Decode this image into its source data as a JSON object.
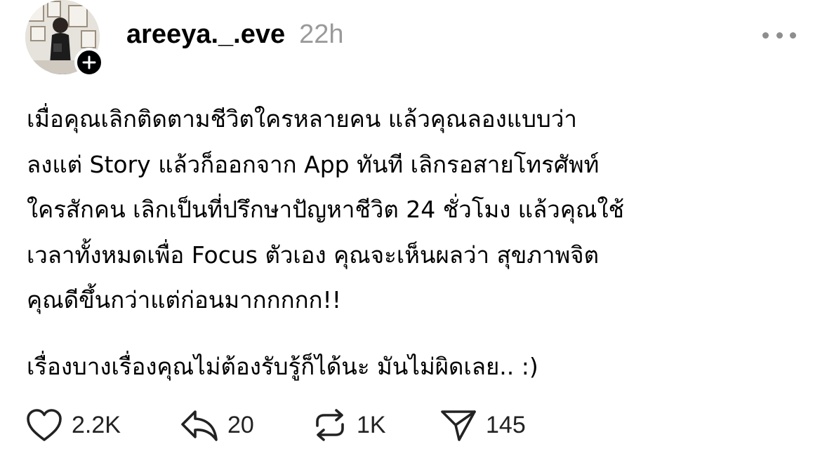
{
  "post": {
    "username": "areeya._.eve",
    "timestamp": "22h",
    "body_paragraphs": [
      "เมื่อคุณเลิกติดตามชีวิตใครหลายคน แล้วคุณลองแบบว่า\nลงแต่ Story แล้วก็ออกจาก App ทันที เลิกรอสายโทรศัพท์\nใครสักคน เลิกเป็นที่ปรึกษาปัญหาชีวิต 24 ชั่วโมง แล้วคุณใช้\nเวลาทั้งหมดเพื่อ Focus ตัวเอง คุณจะเห็นผลว่า สุขภาพจิต\nคุณดีขึ้นกว่าแต่ก่อนมากกกกก!!",
      "เรื่องบางเรื่องคุณไม่ต้องรับรู้ก็ได้นะ มันไม่ผิดเลย.. :)"
    ]
  },
  "actions": {
    "like_count": "2.2K",
    "reply_count": "20",
    "repost_count": "1K",
    "share_count": "145"
  },
  "icons": {
    "like": "heart-icon",
    "reply": "reply-arrow-icon",
    "repost": "repost-icon",
    "share": "send-icon",
    "more": "more-horizontal-icon",
    "follow": "plus-icon"
  },
  "colors": {
    "text": "#000000",
    "timestamp": "#9a9a9a",
    "icon_gray": "#8e8e8e",
    "follow_badge": "#000000"
  }
}
